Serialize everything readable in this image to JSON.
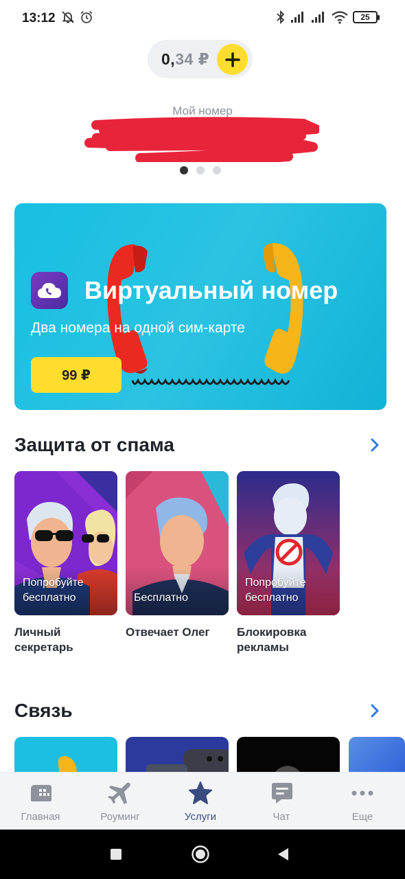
{
  "status_bar": {
    "time": "13:12",
    "battery": "25",
    "icons": [
      "bell-off-icon",
      "alarm-icon",
      "bluetooth-icon",
      "signal-icon",
      "signal-icon",
      "wifi-icon",
      "battery-icon"
    ]
  },
  "balance": {
    "value_main": "0,",
    "value_cents": "34 ₽",
    "add_icon": "plus-icon"
  },
  "number": {
    "label": "Мой номер",
    "pager_count": 3,
    "pager_active": 0
  },
  "banner": {
    "title": "Виртуальный номер",
    "subtitle": "Два номера на одной сим-карте",
    "price": "99 ₽",
    "icon": "cloud-phone-icon"
  },
  "sections": {
    "spam": {
      "title": "Защита от спама",
      "cards": [
        {
          "badge_line1": "Попробуйте",
          "badge_line2": "бесплатно",
          "caption_line1": "Личный",
          "caption_line2": "секретарь"
        },
        {
          "badge_line1": "Бесплатно",
          "badge_line2": "",
          "caption_line1": "Отвечает Олег",
          "caption_line2": ""
        },
        {
          "badge_line1": "Попробуйте",
          "badge_line2": "бесплатно",
          "caption_line1": "Блокировка",
          "caption_line2": "рекламы"
        }
      ]
    },
    "connection": {
      "title": "Связь"
    }
  },
  "bottom_nav": {
    "items": [
      {
        "label": "Главная",
        "icon": "home-icon",
        "active": false
      },
      {
        "label": "Роуминг",
        "icon": "airplane-icon",
        "active": false
      },
      {
        "label": "Услуги",
        "icon": "star-icon",
        "active": true
      },
      {
        "label": "Чат",
        "icon": "chat-icon",
        "active": false
      },
      {
        "label": "Еще",
        "icon": "more-icon",
        "active": false
      }
    ]
  },
  "colors": {
    "accent_yellow": "#ffdd2d",
    "banner_blue": "#1cbfe2",
    "active_nav": "#3a4b80",
    "inactive_nav": "#8d929b",
    "arrow_blue": "#2f7ae5"
  }
}
